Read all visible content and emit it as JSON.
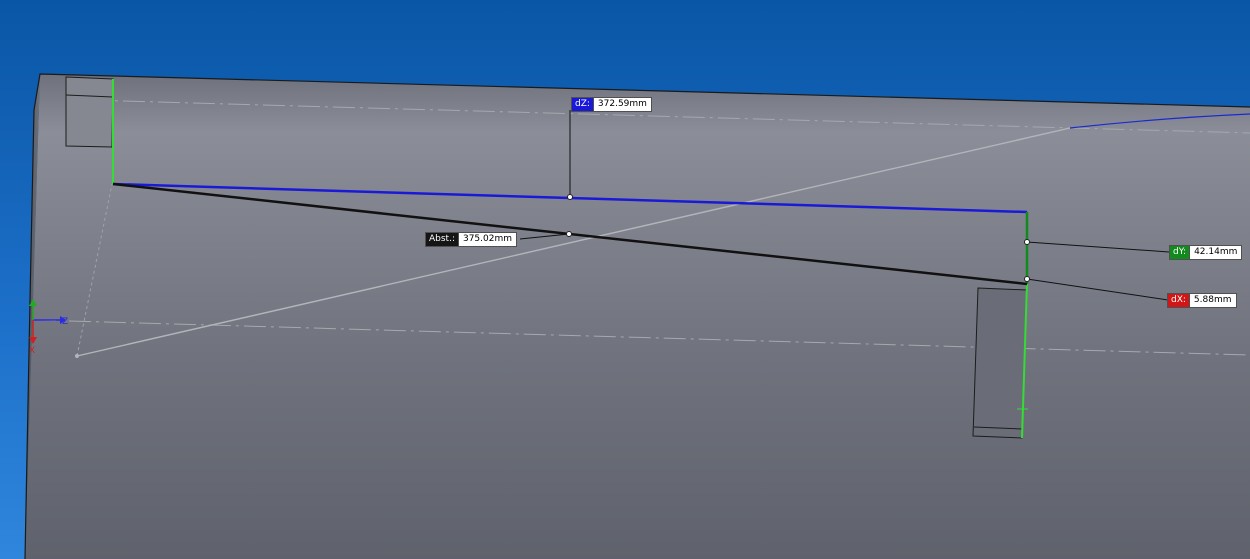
{
  "measurement": {
    "dz": {
      "tag": "dZ:",
      "value": "372.59mm",
      "color": "#1a1ad6"
    },
    "distance": {
      "tag": "Abst.:",
      "value": "375.02mm",
      "color": "#151515"
    },
    "dy": {
      "tag": "dY:",
      "value": "42.14mm",
      "color": "#118a1e"
    },
    "dx": {
      "tag": "dX:",
      "value": "5.88mm",
      "color": "#d01616"
    }
  },
  "triad": {
    "z_label": "Z",
    "x_label": "X"
  },
  "colors": {
    "background_top": "#0a56a6",
    "background_bottom": "#2f86dc",
    "part_face": "#7d808a",
    "dz_line": "#1a1ad6",
    "dy_line": "#118a1e",
    "selected_edge": "#33dd33",
    "distance_line": "#111111"
  }
}
